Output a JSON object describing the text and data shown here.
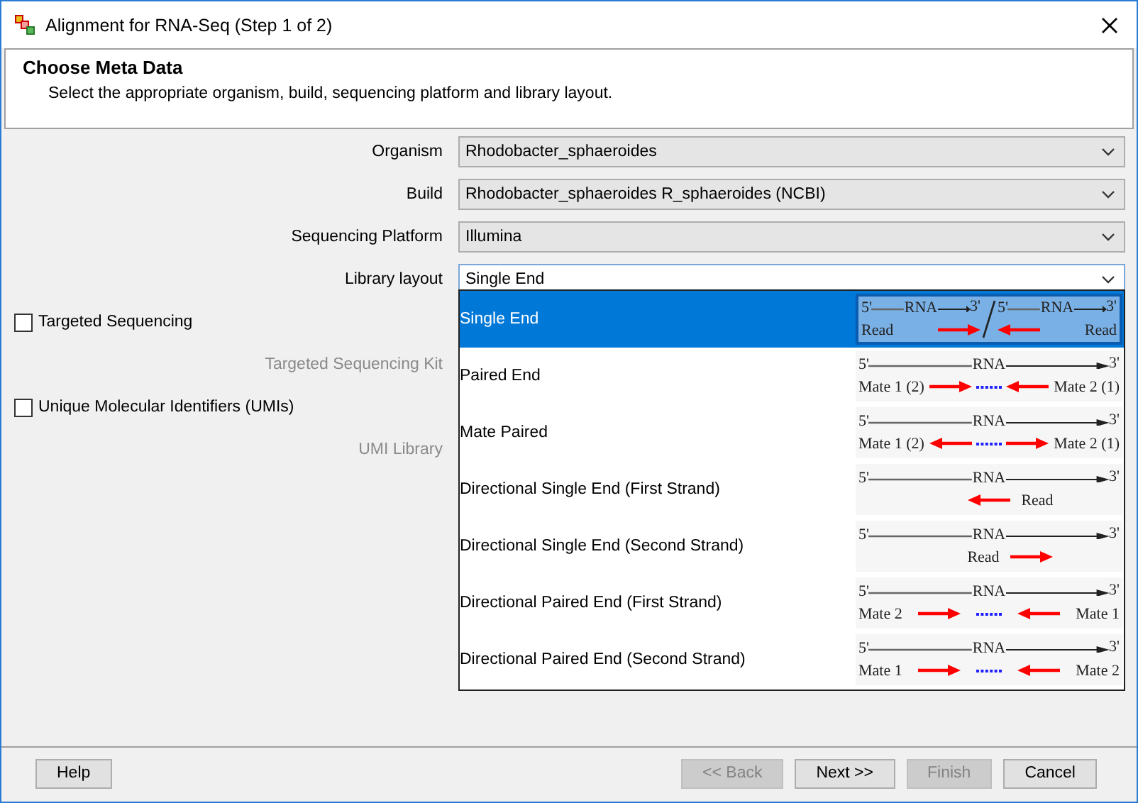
{
  "window": {
    "title": "Alignment for RNA-Seq (Step 1 of 2)"
  },
  "header": {
    "title": "Choose Meta Data",
    "subtitle": "Select the appropriate organism, build, sequencing platform and library layout."
  },
  "fields": [
    {
      "label": "Organism",
      "value": "Rhodobacter_sphaeroides",
      "open": false
    },
    {
      "label": "Build",
      "value": "Rhodobacter_sphaeroides R_sphaeroides (NCBI)",
      "open": false
    },
    {
      "label": "Sequencing Platform",
      "value": "Illumina",
      "open": false
    },
    {
      "label": "Library layout",
      "value": "Single End",
      "open": true
    }
  ],
  "sections": [
    {
      "checkbox": {
        "label": "Targeted Sequencing",
        "checked": false
      },
      "sub_label": {
        "text": "Targeted Sequencing Kit",
        "disabled": true
      }
    },
    {
      "checkbox": {
        "label": "Unique Molecular Identifiers (UMIs)",
        "checked": false
      },
      "sub_label": {
        "text": "UMI Library",
        "disabled": true
      }
    }
  ],
  "dropdown": {
    "items": [
      {
        "label": "Single End",
        "selected": true,
        "diagram": {
          "kind": "split",
          "parts": [
            {
              "strand": {
                "five": "5'",
                "mid": "RNA",
                "three": "3'"
              },
              "reads": {
                "centered": false,
                "tokens": [
                  {
                    "kind": "text",
                    "text": "Read"
                  },
                  {
                    "kind": "arrow",
                    "points_left": false
                  }
                ]
              }
            },
            {
              "strand": {
                "five": "5'",
                "mid": "RNA",
                "three": "3'"
              },
              "reads": {
                "centered": false,
                "tokens": [
                  {
                    "kind": "arrow",
                    "points_left": true
                  },
                  {
                    "kind": "text",
                    "text": "Read"
                  }
                ]
              }
            }
          ]
        }
      },
      {
        "label": "Paired End",
        "selected": false,
        "diagram": {
          "kind": "full",
          "parts": [
            {
              "strand": {
                "five": "5'",
                "mid": "RNA",
                "three": "3'"
              },
              "reads": {
                "centered": false,
                "tokens": [
                  {
                    "kind": "text",
                    "text": "Mate 1 (2)"
                  },
                  {
                    "kind": "arrow",
                    "points_left": false
                  },
                  {
                    "kind": "dots"
                  },
                  {
                    "kind": "arrow",
                    "points_left": true
                  },
                  {
                    "kind": "text",
                    "text": "Mate 2 (1)"
                  }
                ]
              }
            }
          ]
        }
      },
      {
        "label": "Mate Paired",
        "selected": false,
        "diagram": {
          "kind": "full",
          "parts": [
            {
              "strand": {
                "five": "5'",
                "mid": "RNA",
                "three": "3'"
              },
              "reads": {
                "centered": false,
                "tokens": [
                  {
                    "kind": "text",
                    "text": "Mate 1 (2)"
                  },
                  {
                    "kind": "arrow",
                    "points_left": true
                  },
                  {
                    "kind": "dots"
                  },
                  {
                    "kind": "arrow",
                    "points_left": false
                  },
                  {
                    "kind": "text",
                    "text": "Mate 2 (1)"
                  }
                ]
              }
            }
          ]
        }
      },
      {
        "label": "Directional Single End (First Strand)",
        "selected": false,
        "diagram": {
          "kind": "full",
          "parts": [
            {
              "strand": {
                "five": "5'",
                "mid": "RNA",
                "three": "3'"
              },
              "reads": {
                "centered": true,
                "tokens": [
                  {
                    "kind": "arrow",
                    "points_left": true
                  },
                  {
                    "kind": "text",
                    "text": "Read"
                  }
                ]
              }
            }
          ]
        }
      },
      {
        "label": "Directional Single End (Second Strand)",
        "selected": false,
        "diagram": {
          "kind": "full",
          "parts": [
            {
              "strand": {
                "five": "5'",
                "mid": "RNA",
                "three": "3'"
              },
              "reads": {
                "centered": true,
                "tokens": [
                  {
                    "kind": "text",
                    "text": "Read"
                  },
                  {
                    "kind": "arrow",
                    "points_left": false
                  }
                ]
              }
            }
          ]
        }
      },
      {
        "label": "Directional Paired End (First Strand)",
        "selected": false,
        "diagram": {
          "kind": "full",
          "parts": [
            {
              "strand": {
                "five": "5'",
                "mid": "RNA",
                "three": "3'"
              },
              "reads": {
                "centered": false,
                "tokens": [
                  {
                    "kind": "text",
                    "text": "Mate 2"
                  },
                  {
                    "kind": "arrow",
                    "points_left": false
                  },
                  {
                    "kind": "dots"
                  },
                  {
                    "kind": "arrow",
                    "points_left": true
                  },
                  {
                    "kind": "text",
                    "text": "Mate 1"
                  }
                ]
              }
            }
          ]
        }
      },
      {
        "label": "Directional Paired End (Second Strand)",
        "selected": false,
        "diagram": {
          "kind": "full",
          "parts": [
            {
              "strand": {
                "five": "5'",
                "mid": "RNA",
                "three": "3'"
              },
              "reads": {
                "centered": false,
                "tokens": [
                  {
                    "kind": "text",
                    "text": "Mate 1"
                  },
                  {
                    "kind": "arrow",
                    "points_left": false
                  },
                  {
                    "kind": "dots"
                  },
                  {
                    "kind": "arrow",
                    "points_left": true
                  },
                  {
                    "kind": "text",
                    "text": "Mate 2"
                  }
                ]
              }
            }
          ]
        }
      }
    ]
  },
  "help_button": {
    "label": "Help",
    "disabled": false
  },
  "buttons": [
    {
      "label": "<< Back",
      "disabled": true
    },
    {
      "label": "Next >>",
      "disabled": false
    },
    {
      "label": "Finish",
      "disabled": true
    },
    {
      "label": "Cancel",
      "disabled": false
    }
  ]
}
